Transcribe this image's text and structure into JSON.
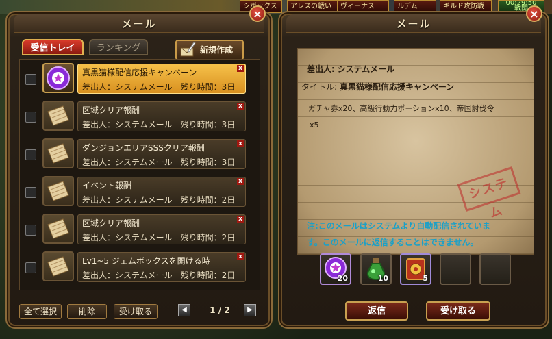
{
  "top_bar": {
    "item1": "シボックス",
    "item2": "アレスの戦い",
    "item3": "ヴィーナス",
    "item4": "ルデム",
    "item5": "ギルド攻防戦",
    "timer": "00:29:50",
    "timer_label": "戦闘"
  },
  "left_panel": {
    "title": "メール",
    "tabs": [
      "受信トレイ",
      "ランキング"
    ],
    "new_button": "新規作成",
    "mails": [
      {
        "subject": "真黒猫様配信応援キャンペーン",
        "sender": "差出人：システムメール",
        "remaining": "残り時間：3日",
        "icon": "gacha-ticket-icon",
        "selected": true
      },
      {
        "subject": "区域クリア報酬",
        "sender": "差出人：システムメール",
        "remaining": "残り時間：3日",
        "icon": "scroll-icon",
        "selected": false
      },
      {
        "subject": "ダンジョンエリアSSSクリア報酬",
        "sender": "差出人：システムメール",
        "remaining": "残り時間：3日",
        "icon": "scroll-icon",
        "selected": false
      },
      {
        "subject": "イベント報酬",
        "sender": "差出人：システムメール",
        "remaining": "残り時間：2日",
        "icon": "scroll-icon",
        "selected": false
      },
      {
        "subject": "区域クリア報酬",
        "sender": "差出人：システムメール",
        "remaining": "残り時間：2日",
        "icon": "scroll-icon",
        "selected": false
      },
      {
        "subject": "Lv1~5 ジェムボックスを開ける時",
        "sender": "差出人：システムメール",
        "remaining": "残り時間：2日",
        "icon": "scroll-icon",
        "selected": false
      }
    ],
    "select_all": "全て選択",
    "delete": "削除",
    "receive": "受け取る",
    "page": "1 / 2",
    "delete_mark": "x"
  },
  "right_panel": {
    "title": "メール",
    "sender_label": "差出人:",
    "sender_value": "システムメール",
    "title_label": "タイトル:",
    "title_value": "真黒猫様配信応援キャンペーン",
    "body_line1": "ガチャ券x20、高級行動力ポーションx10、帝国討伐令",
    "body_line2": "x5",
    "stamp": "システム",
    "notice_line1": "注:このメールはシステムより自動配信されていま",
    "notice_line2": "す。このメールに返信することはできません。",
    "attachments": [
      {
        "icon": "gacha-ticket-icon",
        "qty": "20"
      },
      {
        "icon": "potion-icon",
        "qty": "10"
      },
      {
        "icon": "imperial-order-icon",
        "qty": "5"
      },
      {
        "icon": "empty-slot",
        "qty": ""
      },
      {
        "icon": "empty-slot",
        "qty": ""
      }
    ],
    "reply": "返信",
    "receive": "受け取る"
  },
  "colors": {
    "accent": "#d89020",
    "notice": "#1aa0c8",
    "close": "#c0301c"
  }
}
